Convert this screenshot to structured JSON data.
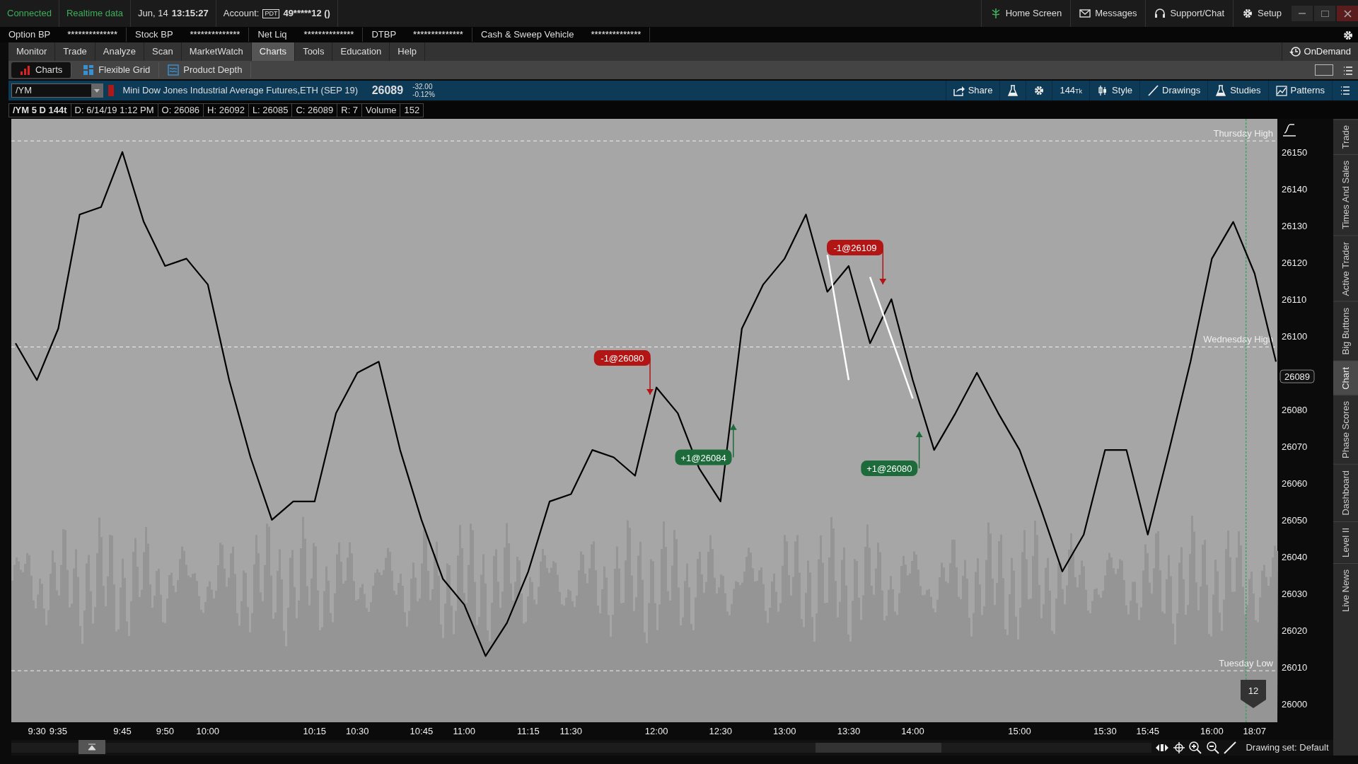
{
  "status_bar": {
    "connection": "Connected",
    "data_feed": "Realtime data",
    "date": "Jun, 14",
    "time": "13:15:27",
    "account_label": "Account:",
    "account_badge": "PDT",
    "account": "49*****12 ()"
  },
  "header_nav": [
    {
      "label": "Home Screen",
      "kind": "home"
    },
    {
      "label": "Messages",
      "kind": "mail"
    },
    {
      "label": "Support/Chat",
      "kind": "headset"
    },
    {
      "label": "Setup",
      "kind": "gear"
    }
  ],
  "balances": [
    {
      "label": "Option BP",
      "value": "**************"
    },
    {
      "label": "Stock BP",
      "value": "**************"
    },
    {
      "label": "Net Liq",
      "value": "**************"
    },
    {
      "label": "DTBP",
      "value": "**************"
    },
    {
      "label": "Cash & Sweep Vehicle",
      "value": "**************"
    }
  ],
  "menu": [
    {
      "label": "Monitor",
      "selected": false
    },
    {
      "label": "Trade",
      "selected": false
    },
    {
      "label": "Analyze",
      "selected": false
    },
    {
      "label": "Scan",
      "selected": false
    },
    {
      "label": "MarketWatch",
      "selected": false
    },
    {
      "label": "Charts",
      "selected": true
    },
    {
      "label": "Tools",
      "selected": false
    },
    {
      "label": "Education",
      "selected": false
    },
    {
      "label": "Help",
      "selected": false
    }
  ],
  "ondemand": "OnDemand",
  "subtabs": [
    {
      "label": "Charts",
      "kind": "charts",
      "selected": true
    },
    {
      "label": "Flexible Grid",
      "kind": "grid",
      "selected": false
    },
    {
      "label": "Product Depth",
      "kind": "depth",
      "selected": false
    }
  ],
  "symbol_bar": {
    "symbol": "/YM",
    "description": "Mini Dow Jones Industrial Average Futures,ETH (SEP 19)",
    "last": "26089",
    "change": "-32.00",
    "change_pct": "-0.12%",
    "tools": [
      {
        "label": "Share",
        "kind": "share"
      },
      {
        "kind": "flask"
      },
      {
        "kind": "gear"
      },
      {
        "label": "144",
        "suffix": "Tk",
        "kind": "aggregation"
      },
      {
        "label": "Style",
        "kind": "style"
      },
      {
        "label": "Drawings",
        "kind": "drawings"
      },
      {
        "label": "Studies",
        "kind": "studies"
      },
      {
        "label": "Patterns",
        "kind": "patterns"
      },
      {
        "kind": "menu"
      }
    ]
  },
  "info_bar": [
    "/YM 5 D 144t",
    "D: 6/14/19 1:12 PM",
    "O: 26086",
    "H: 26092",
    "L: 26085",
    "C: 26089",
    "R: 7",
    "Volume",
    "152"
  ],
  "chart": {
    "price_marker": "26089",
    "bubble": "12",
    "trades": [
      {
        "text": "-1@26080",
        "kind": "sell"
      },
      {
        "text": "+1@26084",
        "kind": "buy"
      },
      {
        "text": "-1@26109",
        "kind": "sell"
      },
      {
        "text": "+1@26080",
        "kind": "buy"
      }
    ],
    "chart_data": {
      "type": "line",
      "categories": [
        null,
        "9:30",
        "9:35",
        null,
        null,
        "9:45",
        null,
        "9:50",
        null,
        "10:00",
        null,
        null,
        null,
        null,
        "10:15",
        null,
        "10:30",
        null,
        null,
        "10:45",
        null,
        "11:00",
        null,
        null,
        "11:15",
        null,
        "11:30",
        null,
        null,
        null,
        "12:00",
        null,
        null,
        "12:30",
        null,
        null,
        "13:00",
        null,
        null,
        "13:30",
        null,
        null,
        "14:00",
        null,
        null,
        null,
        null,
        "15:00",
        null,
        null,
        null,
        "15:30",
        null,
        "15:45",
        null,
        null,
        "16:00",
        null,
        "18:07",
        null
      ],
      "grid": false,
      "series": [
        {
          "color": "#000000",
          "values": [
            26098,
            26088,
            26102,
            26133,
            26135,
            26150,
            26131,
            26119,
            26121,
            26114,
            26088,
            26067,
            26050,
            26055,
            26055,
            26079,
            26090,
            26093,
            26069,
            26050,
            26034,
            26027,
            26013,
            26022,
            26036,
            26055,
            26057,
            26069,
            26067,
            26062,
            26086,
            26079,
            26064,
            26055,
            26102,
            26114,
            26121,
            26133,
            26112,
            26119,
            26098,
            26110,
            26088,
            26069,
            26079,
            26090,
            26079,
            26069,
            26053,
            26036,
            26046,
            26069,
            26069,
            26046,
            26069,
            26093,
            26121,
            26131,
            26117,
            26093
          ]
        },
        {
          "color": "#ffffff",
          "values": [
            null,
            null,
            null,
            null,
            null,
            null,
            null,
            null,
            null,
            null,
            null,
            null,
            null,
            null,
            null,
            null,
            null,
            null,
            null,
            null,
            null,
            null,
            null,
            null,
            null,
            null,
            null,
            null,
            null,
            null,
            null,
            null,
            null,
            null,
            null,
            null,
            null,
            null,
            26122,
            26088,
            null,
            null,
            null,
            null,
            null,
            null,
            null,
            null,
            null,
            null,
            null,
            null,
            null,
            null,
            null,
            null,
            null,
            null,
            null,
            null
          ]
        },
        {
          "color": "#ffffff",
          "values": [
            null,
            null,
            null,
            null,
            null,
            null,
            null,
            null,
            null,
            null,
            null,
            null,
            null,
            null,
            null,
            null,
            null,
            null,
            null,
            null,
            null,
            null,
            null,
            null,
            null,
            null,
            null,
            null,
            null,
            null,
            null,
            null,
            null,
            null,
            null,
            null,
            null,
            null,
            null,
            null,
            26116,
            26099.5,
            26083,
            null,
            null,
            null,
            null,
            null,
            null,
            null,
            null,
            null,
            null,
            null,
            null,
            null,
            null,
            null,
            null,
            null
          ]
        }
      ],
      "ylim": [
        25995,
        26159
      ],
      "yticks": [
        26000,
        26010,
        26020,
        26030,
        26040,
        26050,
        26060,
        26070,
        26080,
        26100,
        26110,
        26120,
        26130,
        26140,
        26150
      ],
      "ref_lines": [
        {
          "axis": "y",
          "value": 26153,
          "label": "Thursday High"
        },
        {
          "axis": "y",
          "value": 26097,
          "label": "Wednesday High"
        },
        {
          "axis": "y",
          "value": 26009,
          "label": "Tuesday Low"
        }
      ]
    }
  },
  "bottom_bar": {
    "drawing_set": "Drawing set: Default"
  },
  "side_tabs": [
    {
      "label": "Trade",
      "selected": false
    },
    {
      "label": "Times And Sales",
      "selected": false
    },
    {
      "label": "Active Trader",
      "selected": false
    },
    {
      "label": "Big Buttons",
      "selected": false
    },
    {
      "label": "Chart",
      "selected": true
    },
    {
      "label": "Phase Scores",
      "selected": false
    },
    {
      "label": "Dashboard",
      "selected": false
    },
    {
      "label": "Level II",
      "selected": false
    },
    {
      "label": "Live News",
      "selected": false
    }
  ]
}
